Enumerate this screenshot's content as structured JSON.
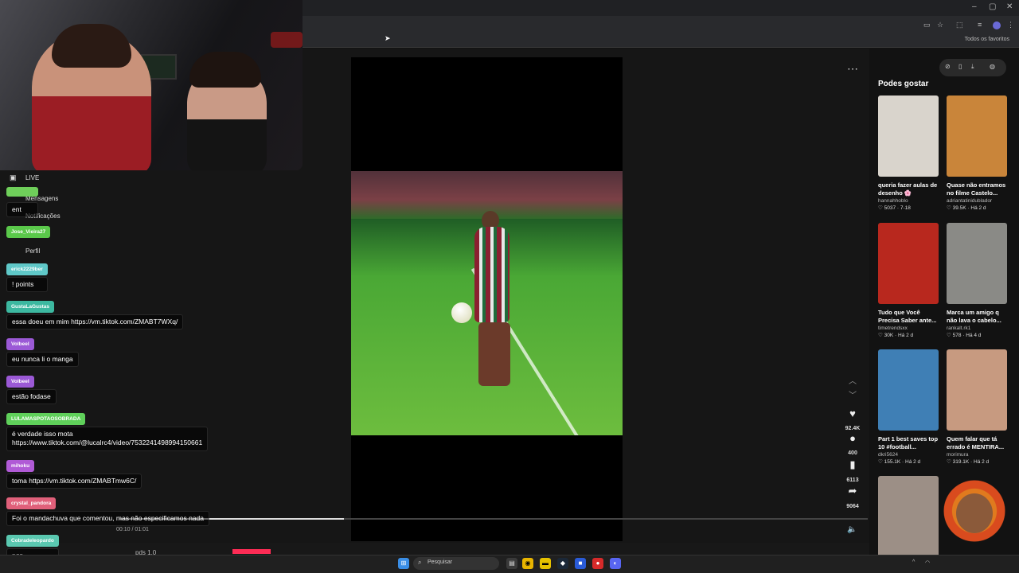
{
  "browser": {
    "window_controls": [
      "–",
      "▢",
      "✕"
    ],
    "bookmarks_label": "Todos os favoritos"
  },
  "left_nav": {
    "items": [
      "LIVE",
      "Mensagens",
      "Notificações",
      "Perfil"
    ]
  },
  "player": {
    "time": "00:10 / 01:01",
    "progress_fraction": 0.3,
    "likes": "92.4K",
    "comments": "400",
    "saves": "6113",
    "shares": "9064",
    "bottom_label": "pds 1.0"
  },
  "sidebar": {
    "title": "Podes gostar",
    "cards": [
      {
        "title": "queria fazer aulas de desenho 🌸",
        "user": "hannahhoblo",
        "stats": "♡ 5037 · 7-18",
        "color": "#d9d4cc"
      },
      {
        "title": "Quase não entramos no filme Castelo...",
        "user": "adriantatinidublador",
        "stats": "♡ 39.5K · Há 2 d",
        "color": "#c9853a"
      },
      {
        "title": "Tudo que Você Precisa Saber ante...",
        "user": "timetrendsxx",
        "stats": "♡ 30K · Há 2 d",
        "color": "#b8281e"
      },
      {
        "title": "Marca um amigo q não lava o cabelo...",
        "user": "rankalt.rk1",
        "stats": "♡ 578 · Há 4 d",
        "color": "#8a8a86"
      },
      {
        "title": "Part 1 best saves top 10 #football...",
        "user": "dkri5624",
        "stats": "♡ 155.1K · Há 2 d",
        "color": "#3f7fb5"
      },
      {
        "title": "Quem falar que tá errado é MENTIRA...",
        "user": "morimura",
        "stats": "♡ 319.1K · Há 2 d",
        "color": "#c79a80"
      },
      {
        "title": "",
        "user": "",
        "stats": "",
        "color": "#9c8f86"
      }
    ]
  },
  "chat": {
    "messages": [
      {
        "name": "",
        "text": "ent",
        "color": "#6fcf5a"
      },
      {
        "name": "Jose_Vieira27",
        "text": "",
        "color": "#5ac84a"
      },
      {
        "name": "erick2229ber",
        "text": "! points",
        "color": "#5fc8c8"
      },
      {
        "name": "GustaLaGustas",
        "text": "essa doeu em mim https://vm.tiktok.com/ZMABT7WXq/",
        "color": "#3cb8a0"
      },
      {
        "name": "Volbeel",
        "text": "eu nunca li o manga",
        "color": "#9b59d6"
      },
      {
        "name": "Volbeel",
        "text": "estão fodase",
        "color": "#9b59d6"
      },
      {
        "name": "LULAMASPOTAOSOBRADA",
        "text": "é verdade isso mota\nhttps://www.tiktok.com/@lucalrc4/video/7532241498994150661",
        "color": "#5fd05a"
      },
      {
        "name": "mihoku",
        "text": "toma https://vm.tiktok.com/ZMABTmw6C/",
        "color": "#b05ad6"
      },
      {
        "name": "crystal_pandora",
        "text": "Foi o mandachuva que comentou, mas não especificamos nada",
        "color": "#e0607a"
      },
      {
        "name": "Cobradeleopardo",
        "text": "pqp",
        "color": "#5ac8b0"
      }
    ]
  },
  "taskbar": {
    "search_placeholder": "Pesquisar"
  }
}
